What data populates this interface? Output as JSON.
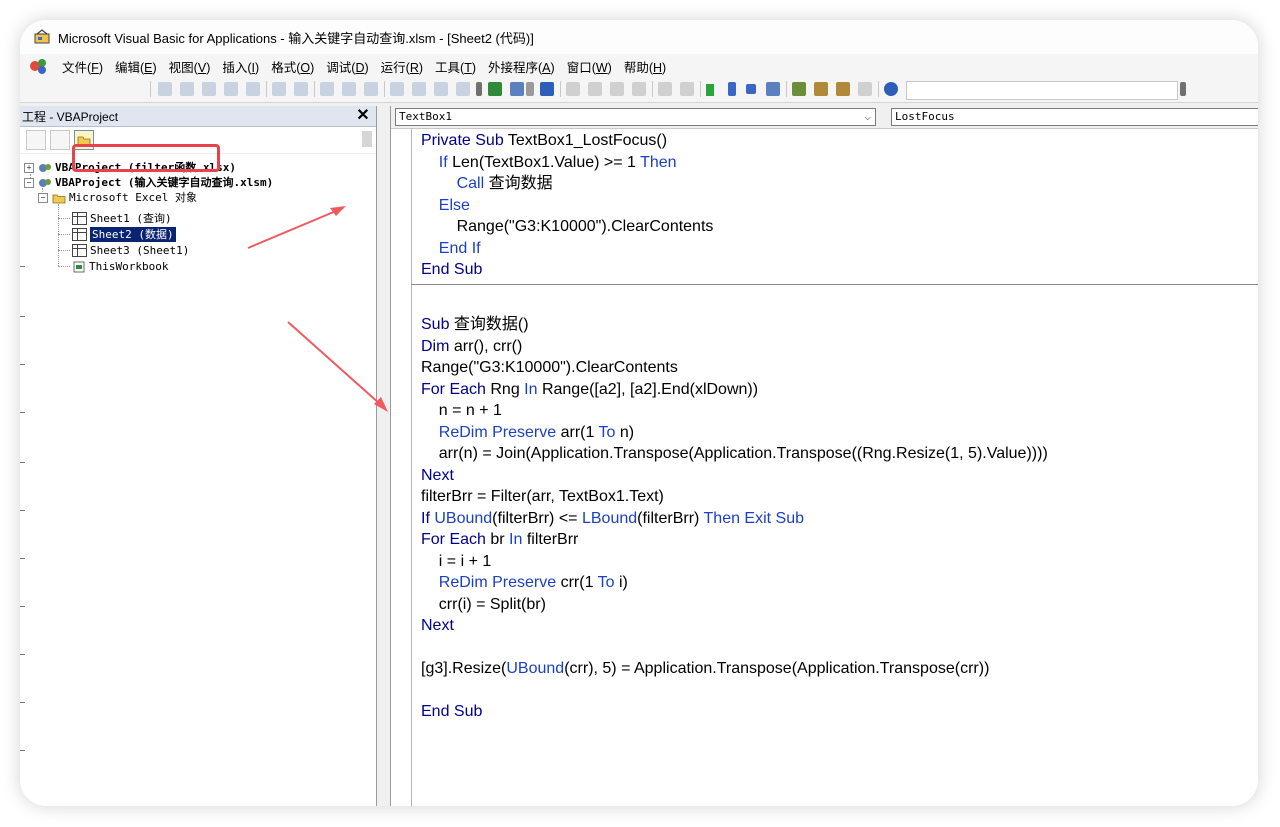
{
  "window": {
    "title": "Microsoft Visual Basic for Applications - 输入关键字自动查询.xlsm - [Sheet2 (代码)]"
  },
  "menu": [
    {
      "label": "文件(",
      "acc": "F",
      "tail": ")"
    },
    {
      "label": "编辑(",
      "acc": "E",
      "tail": ")"
    },
    {
      "label": "视图(",
      "acc": "V",
      "tail": ")"
    },
    {
      "label": "插入(",
      "acc": "I",
      "tail": ")"
    },
    {
      "label": "格式(",
      "acc": "O",
      "tail": ")"
    },
    {
      "label": "调试(",
      "acc": "D",
      "tail": ")"
    },
    {
      "label": "运行(",
      "acc": "R",
      "tail": ")"
    },
    {
      "label": "工具(",
      "acc": "T",
      "tail": ")"
    },
    {
      "label": "外接程序(",
      "acc": "A",
      "tail": ")"
    },
    {
      "label": "窗口(",
      "acc": "W",
      "tail": ")"
    },
    {
      "label": "帮助(",
      "acc": "H",
      "tail": ")"
    }
  ],
  "project": {
    "header": "工程 - VBAProject",
    "close": "✕",
    "nodes": {
      "p1": "VBAProject (filter函数.xlsx)",
      "p2": "VBAProject (输入关键字自动查询.xlsm)",
      "folder": "Microsoft Excel 对象",
      "sheet1": "Sheet1 (查询)",
      "sheet2": "Sheet2 (数据)",
      "sheet3": "Sheet3 (Sheet1)",
      "wb": "ThisWorkbook"
    },
    "expand_plus": "+",
    "expand_minus": "−"
  },
  "code": {
    "object_combo": "TextBox1",
    "proc_combo": "LostFocus",
    "chevron": "⌵",
    "lines": [
      {
        "k": "Private Sub ",
        "t": "TextBox1_LostFocus()"
      },
      {
        "k": "",
        "t": "    ",
        "k2": "If ",
        "t2": "Len(TextBox1.Value) >= 1 ",
        "k3": "Then"
      },
      {
        "k": "",
        "t": "        ",
        "k2": "Call ",
        "t2": "查询数据"
      },
      {
        "k": "",
        "t": "    ",
        "k2": "Else"
      },
      {
        "k": "",
        "t": "        Range(\"G3:K10000\").ClearContents"
      },
      {
        "k": "",
        "t": "    ",
        "k2": "End If"
      },
      {
        "k": "End Sub",
        "t": ""
      },
      {
        "k": "",
        "t": ""
      },
      {
        "k": "Sub ",
        "t": "查询数据()"
      },
      {
        "k": "Dim ",
        "t": "arr(), crr()"
      },
      {
        "k": "",
        "t": "Range(\"G3:K10000\").ClearContents"
      },
      {
        "k": "For Each ",
        "t": "Rng ",
        "k2": "In ",
        "t2": "Range([a2], [a2].End(xlDown))"
      },
      {
        "k": "",
        "t": "    n = n + 1"
      },
      {
        "k": "",
        "t": "    ",
        "k2": "ReDim Preserve ",
        "t2": "arr(1 ",
        "k3": "To ",
        "t3": "n)"
      },
      {
        "k": "",
        "t": "    arr(n) = Join(Application.Transpose(Application.Transpose((Rng.Resize(1, 5).Value))))"
      },
      {
        "k": "Next",
        "t": ""
      },
      {
        "k": "",
        "t": "filterBrr = Filter(arr, TextBox1.Text)"
      },
      {
        "k": "If ",
        "t": "",
        "k2": "UBound",
        "t2": "(filterBrr) <= ",
        "k3": "LBound",
        "t3": "(filterBrr) ",
        "k4": "Then Exit Sub"
      },
      {
        "k": "For Each ",
        "t": "br ",
        "k2": "In ",
        "t2": "filterBrr"
      },
      {
        "k": "",
        "t": "    i = i + 1"
      },
      {
        "k": "",
        "t": "    ",
        "k2": "ReDim Preserve ",
        "t2": "crr(1 ",
        "k3": "To ",
        "t3": "i)"
      },
      {
        "k": "",
        "t": "    crr(i) = Split(br)"
      },
      {
        "k": "Next",
        "t": ""
      },
      {
        "k": "",
        "t": ""
      },
      {
        "k": "",
        "t": "[g3].Resize(",
        "k2": "UBound",
        "t2": "(crr), 5) = Application.Transpose(Application.Transpose(crr))"
      },
      {
        "k": "",
        "t": ""
      },
      {
        "k": "End Sub",
        "t": ""
      }
    ]
  },
  "colors": {
    "keyword": "#00008b",
    "highlight": "#e8434b",
    "selection": "#0a2472"
  }
}
